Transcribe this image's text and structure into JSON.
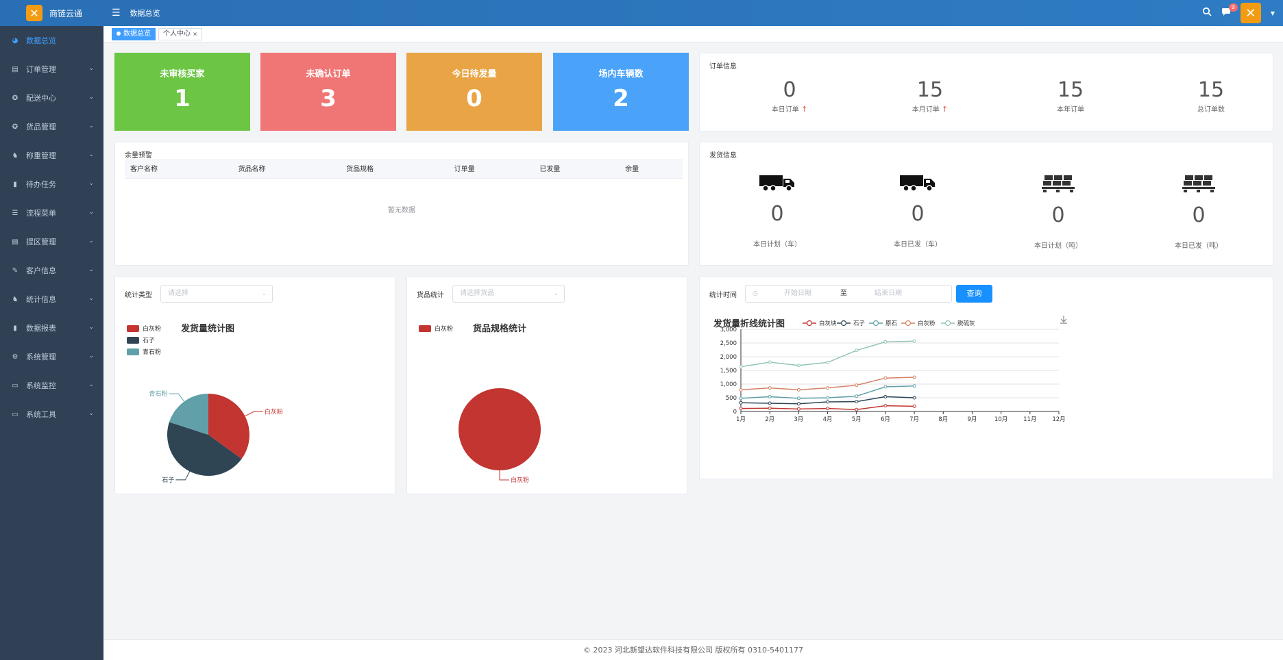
{
  "app": {
    "title": "商链云通"
  },
  "topbar": {
    "breadcrumb": "数据总览",
    "notification_count": "9"
  },
  "tags": [
    "数据总览",
    "个人中心"
  ],
  "sidebar": {
    "items": [
      {
        "label": "数据总览",
        "icon": "dashboard-icon"
      },
      {
        "label": "订单管理",
        "icon": "order-icon"
      },
      {
        "label": "配送中心",
        "icon": "delivery-icon"
      },
      {
        "label": "货品管理",
        "icon": "goods-icon"
      },
      {
        "label": "称重管理",
        "icon": "weigh-icon"
      },
      {
        "label": "待办任务",
        "icon": "task-icon"
      },
      {
        "label": "流程菜单",
        "icon": "flow-icon"
      },
      {
        "label": "提区管理",
        "icon": "area-icon"
      },
      {
        "label": "客户信息",
        "icon": "customer-icon"
      },
      {
        "label": "统计信息",
        "icon": "stats-icon"
      },
      {
        "label": "数据报表",
        "icon": "report-icon"
      },
      {
        "label": "系统管理",
        "icon": "gear-icon"
      },
      {
        "label": "系统监控",
        "icon": "monitor-icon"
      },
      {
        "label": "系统工具",
        "icon": "tool-icon"
      }
    ]
  },
  "stats": [
    {
      "title": "未审核买家",
      "value": "1",
      "color": "#6cc644"
    },
    {
      "title": "未确认订单",
      "value": "3",
      "color": "#f07575"
    },
    {
      "title": "今日待发量",
      "value": "0",
      "color": "#e9a446"
    },
    {
      "title": "场内车辆数",
      "value": "2",
      "color": "#4aa3f8"
    }
  ],
  "order_info": {
    "title": "订单信息",
    "items": [
      {
        "value": "0",
        "label": "本日订单"
      },
      {
        "value": "15",
        "label": "本月订单"
      },
      {
        "value": "15",
        "label": "本年订单"
      },
      {
        "value": "15",
        "label": "总订单数"
      }
    ]
  },
  "stock_warning": {
    "title": "余量预警",
    "columns": [
      "客户名称",
      "货品名称",
      "货品规格",
      "订单量",
      "已发量",
      "余量"
    ],
    "empty_text": "暂无数据"
  },
  "shipping_info": {
    "title": "发货信息",
    "items": [
      {
        "value": "0",
        "label": "本日计划（车）",
        "icon": "truck-icon"
      },
      {
        "value": "0",
        "label": "本日已发（车）",
        "icon": "truck-icon"
      },
      {
        "value": "0",
        "label": "本日计划（吨）",
        "icon": "pallet-icon"
      },
      {
        "value": "0",
        "label": "本日已发（吨）",
        "icon": "pallet-icon"
      }
    ]
  },
  "filters": {
    "stat_type_label": "统计类型",
    "stat_type_placeholder": "请选择",
    "goods_stat_label": "货品统计",
    "goods_stat_placeholder": "请选择货品",
    "time_label": "统计时间",
    "start_placeholder": "开始日期",
    "range_sep": "至",
    "end_placeholder": "结束日期",
    "query_label": "查询"
  },
  "footer": {
    "text": "© 2023 河北新望达软件科技有限公司 版权所有 0310-5401177"
  },
  "chart_data": [
    {
      "type": "pie",
      "title": "发货量统计图",
      "legend": [
        "白灰粉",
        "石子",
        "青石粉"
      ],
      "colors": [
        "#c23531",
        "#2f4554",
        "#61a0a8"
      ],
      "values": [
        35,
        45,
        20
      ],
      "labels": [
        "白灰粉",
        "石子",
        "青石粉"
      ]
    },
    {
      "type": "pie",
      "title": "货品规格统计",
      "legend": [
        "白灰粉"
      ],
      "colors": [
        "#c23531"
      ],
      "values": [
        100
      ],
      "labels": [
        "白灰粉"
      ]
    },
    {
      "type": "line",
      "title": "发货量折线统计图",
      "categories": [
        "1月",
        "2月",
        "3月",
        "4月",
        "5月",
        "6月",
        "7月",
        "8月",
        "9月",
        "10月",
        "11月",
        "12月"
      ],
      "ylim": [
        0,
        3000
      ],
      "yticks": [
        "0",
        "500",
        "1,000",
        "1,500",
        "2,000",
        "2,500",
        "3,000"
      ],
      "series": [
        {
          "name": "白灰块",
          "color": "#c23531",
          "values": [
            110,
            120,
            90,
            110,
            70,
            210,
            190
          ]
        },
        {
          "name": "石子",
          "color": "#2f4554",
          "values": [
            320,
            300,
            280,
            350,
            360,
            540,
            500
          ]
        },
        {
          "name": "原石",
          "color": "#61a0a8",
          "values": [
            480,
            540,
            480,
            500,
            560,
            900,
            930
          ]
        },
        {
          "name": "白灰粉",
          "color": "#d48265",
          "values": [
            790,
            860,
            790,
            860,
            960,
            1220,
            1250
          ]
        },
        {
          "name": "脱硫灰",
          "color": "#91c7ae",
          "values": [
            1630,
            1800,
            1680,
            1790,
            2230,
            2540,
            2570
          ]
        }
      ]
    }
  ]
}
